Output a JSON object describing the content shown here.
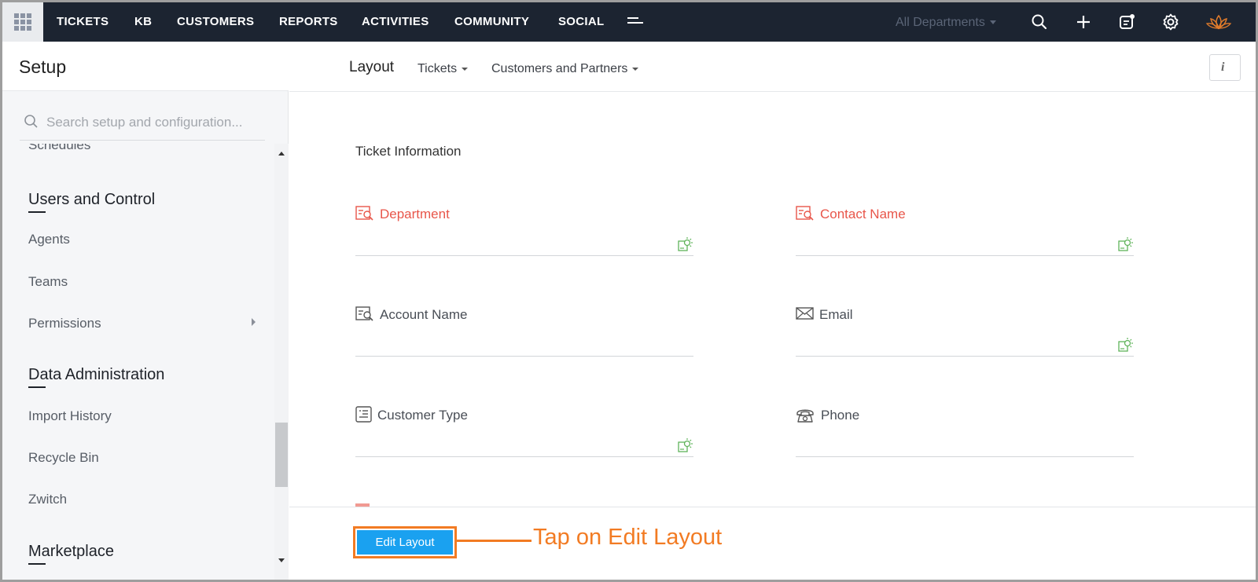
{
  "topnav": {
    "items": [
      "TICKETS",
      "KB",
      "CUSTOMERS",
      "REPORTS",
      "ACTIVITIES",
      "COMMUNITY",
      "SOCIAL"
    ],
    "department": "All Departments",
    "icons": [
      "apps-grid-icon",
      "more-menu-icon",
      "search-icon",
      "plus-icon",
      "notes-icon",
      "gear-icon",
      "lotus-logo-icon"
    ]
  },
  "sidebar": {
    "title": "Setup",
    "search_placeholder": "Search setup and configuration...",
    "clipped_item": "Schedules",
    "sections": [
      {
        "title": "Users and Control",
        "items": [
          "Agents",
          "Teams",
          "Permissions"
        ]
      },
      {
        "title": "Data Administration",
        "items": [
          "Import History",
          "Recycle Bin",
          "Zwitch"
        ]
      },
      {
        "title": "Marketplace",
        "items": []
      }
    ]
  },
  "main": {
    "title": "Layout",
    "tabs": [
      "Tickets",
      "Customers and Partners"
    ],
    "info_label": "i",
    "section_title": "Ticket Information",
    "fields": [
      {
        "label": "Department",
        "required": true,
        "icon": "lookup-icon",
        "hint": true
      },
      {
        "label": "Contact Name",
        "required": true,
        "icon": "lookup-icon",
        "hint": true
      },
      {
        "label": "Account Name",
        "required": false,
        "icon": "lookup-icon",
        "hint": false
      },
      {
        "label": "Email",
        "required": false,
        "icon": "email-icon",
        "hint": true
      },
      {
        "label": "Customer Type",
        "required": false,
        "icon": "picklist-icon",
        "hint": true
      },
      {
        "label": "Phone",
        "required": false,
        "icon": "phone-icon",
        "hint": false
      }
    ],
    "edit_button": "Edit Layout",
    "annotation": "Tap on Edit Layout"
  },
  "colors": {
    "nav_bg": "#1c2431",
    "required_label": "#e8564a",
    "button_blue": "#1aa1f0",
    "annotation_orange": "#f27b23",
    "hint_green": "#5fb35a"
  }
}
